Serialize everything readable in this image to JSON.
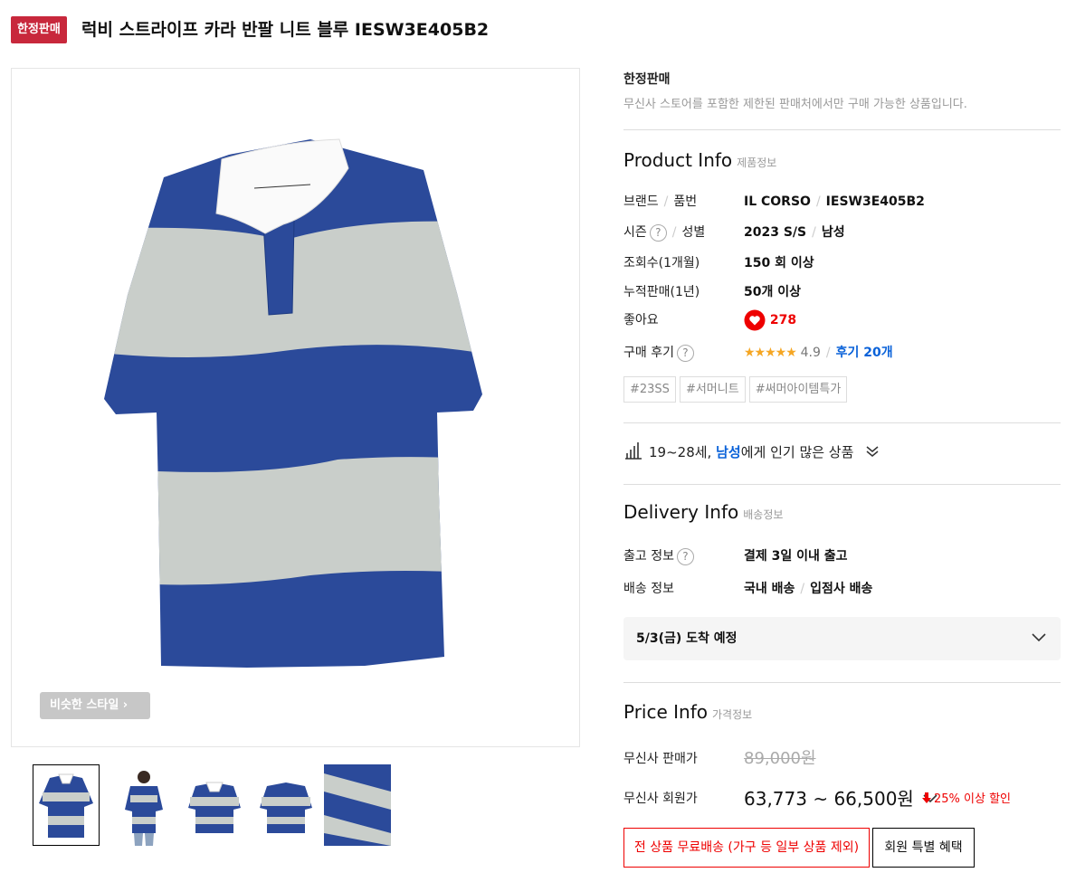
{
  "header": {
    "badge": "한정판매",
    "title": "럭비 스트라이프 카라 반팔 니트 블루 IESW3E405B2"
  },
  "gallery": {
    "similar_style_label": "비슷한 스타일 ›",
    "thumbnail_count": 5,
    "active_thumbnail": 1,
    "knit_colors": {
      "blue": "#2b4a9a",
      "grey": "#c9ceca",
      "collar": "#ffffff"
    }
  },
  "limited": {
    "label": "한정판매",
    "description": "무신사 스토어를 포함한 제한된 판매처에서만 구매 가능한 상품입니다."
  },
  "product_info": {
    "title": "Product Info",
    "subtitle": "제품정보",
    "brand_label": "브랜드",
    "code_label": "품번",
    "brand": "IL CORSO",
    "code": "IESW3E405B2",
    "season_label": "시즌",
    "gender_label": "성별",
    "season": "2023 S/S",
    "gender": "남성",
    "views_label": "조회수(1개월)",
    "views": "150 회 이상",
    "sales_label": "누적판매(1년)",
    "sales": "50개 이상",
    "likes_label": "좋아요",
    "likes": "278",
    "reviews_label": "구매 후기",
    "stars": "★★★★★",
    "rating": "4.9",
    "reviews_link": "후기 20개",
    "tags": [
      "#23SS",
      "#서머니트",
      "#써머아이템특가"
    ]
  },
  "popular": {
    "age": "19~28세,",
    "gender": "남성",
    "suffix": "에게 인기 많은 상품"
  },
  "delivery_info": {
    "title": "Delivery Info",
    "subtitle": "배송정보",
    "shipping_label": "출고 정보",
    "shipping": "결제 3일 이내 출고",
    "delivery_label": "배송 정보",
    "delivery_type": "국내 배송",
    "delivery_method": "입점사 배송",
    "arrival": "5/3(금) 도착 예정"
  },
  "price_info": {
    "title": "Price Info",
    "subtitle": "가격정보",
    "sale_label": "무신사 판매가",
    "sale_price": "89,000원",
    "member_label": "무신사 회원가",
    "member_price": "63,773 ~ 66,500원",
    "discount": "25% 이상 할인",
    "free_shipping_button": "전 상품 무료배송 (가구 등 일부 상품 제외)",
    "member_benefit_button": "회원 특별 혜택"
  }
}
